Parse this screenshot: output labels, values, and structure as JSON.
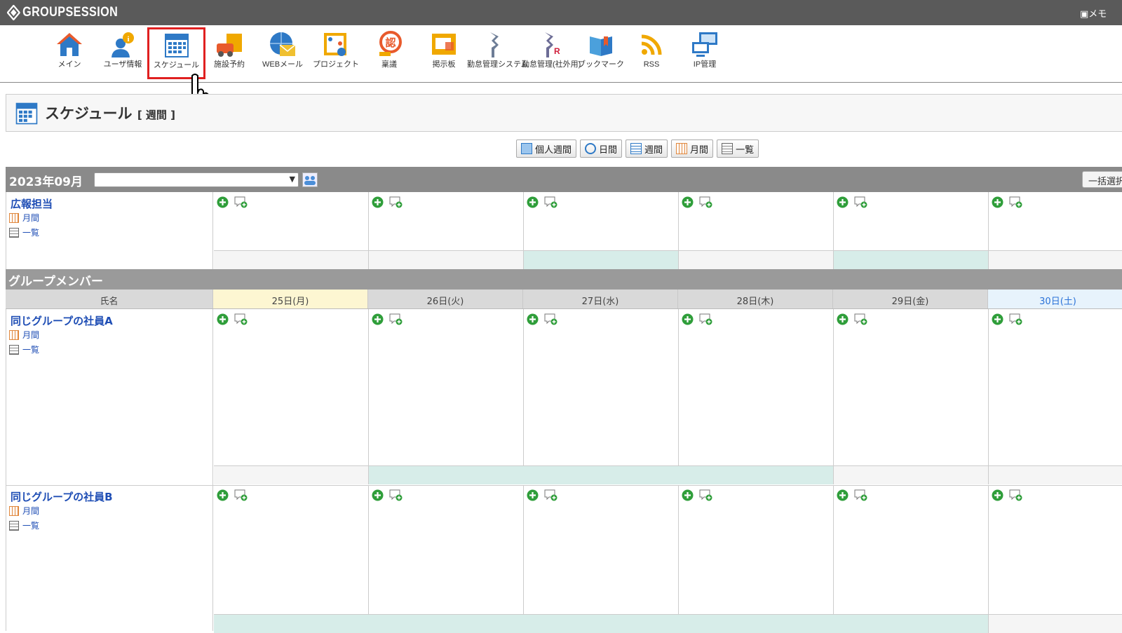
{
  "header": {
    "logo": "GROUPSESSION",
    "memo": "メモ"
  },
  "apps": [
    {
      "label": "メイン",
      "icon": "home-icon"
    },
    {
      "label": "ユーザ情報",
      "icon": "user-info-icon"
    },
    {
      "label": "スケジュール",
      "icon": "schedule-icon",
      "selected": true
    },
    {
      "label": "施設予約",
      "icon": "facility-icon"
    },
    {
      "label": "WEBメール",
      "icon": "webmail-icon"
    },
    {
      "label": "プロジェクト",
      "icon": "project-icon"
    },
    {
      "label": "稟議",
      "icon": "approval-icon"
    },
    {
      "label": "掲示板",
      "icon": "board-icon"
    },
    {
      "label": "勤怠管理システム",
      "icon": "attendance-icon"
    },
    {
      "label": "勤怠管理(社外用)",
      "icon": "attendance-external-icon"
    },
    {
      "label": "ブックマーク",
      "icon": "bookmark-icon"
    },
    {
      "label": "RSS",
      "icon": "rss-icon"
    },
    {
      "label": "IP管理",
      "icon": "ip-icon"
    }
  ],
  "page": {
    "title": "スケジュール",
    "subtitle": "[ 週間 ]"
  },
  "view_buttons": [
    "個人週間",
    "日間",
    "週間",
    "月間",
    "一覧"
  ],
  "month": "2023年09月",
  "bulk_button": "一括選択",
  "group_row": {
    "name": "広報担当",
    "links": [
      "月間",
      "一覧"
    ]
  },
  "section_title": "グループメンバー",
  "table_header": {
    "name_col": "氏名",
    "days": [
      "25日(月)",
      "26日(火)",
      "27日(水)",
      "28日(木)",
      "29日(金)",
      "30日(土)"
    ]
  },
  "members": [
    {
      "name": "同じグループの社員A",
      "links": [
        "月間",
        "一覧"
      ]
    },
    {
      "name": "同じグループの社員B",
      "links": [
        "月間",
        "一覧"
      ]
    }
  ]
}
